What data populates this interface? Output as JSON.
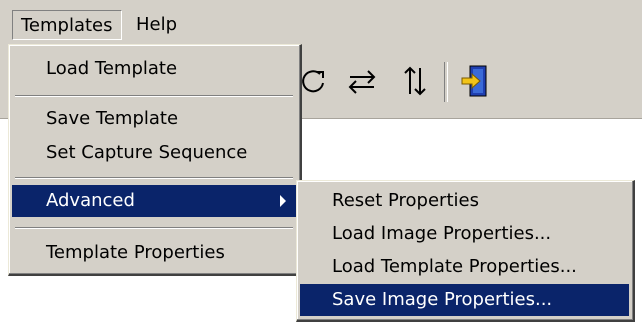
{
  "menubar": {
    "templates_label": "Templates",
    "help_label": "Help"
  },
  "toolbar": {
    "icons": [
      "rotate-icon",
      "swap-horizontal-icon",
      "swap-vertical-icon",
      "exit-door-icon"
    ]
  },
  "templates_menu": {
    "load_template": "Load Template",
    "save_template": "Save Template",
    "set_capture_sequence": "Set Capture Sequence",
    "advanced": "Advanced",
    "template_properties": "Template Properties"
  },
  "advanced_submenu": {
    "reset_properties": "Reset Properties",
    "load_image_properties": "Load Image Properties...",
    "load_template_properties": "Load Template Properties...",
    "save_image_properties": "Save Image Properties..."
  },
  "colors": {
    "menu_bg": "#d4d0c8",
    "highlight_bg": "#0a246a",
    "highlight_text": "#ffffff"
  }
}
